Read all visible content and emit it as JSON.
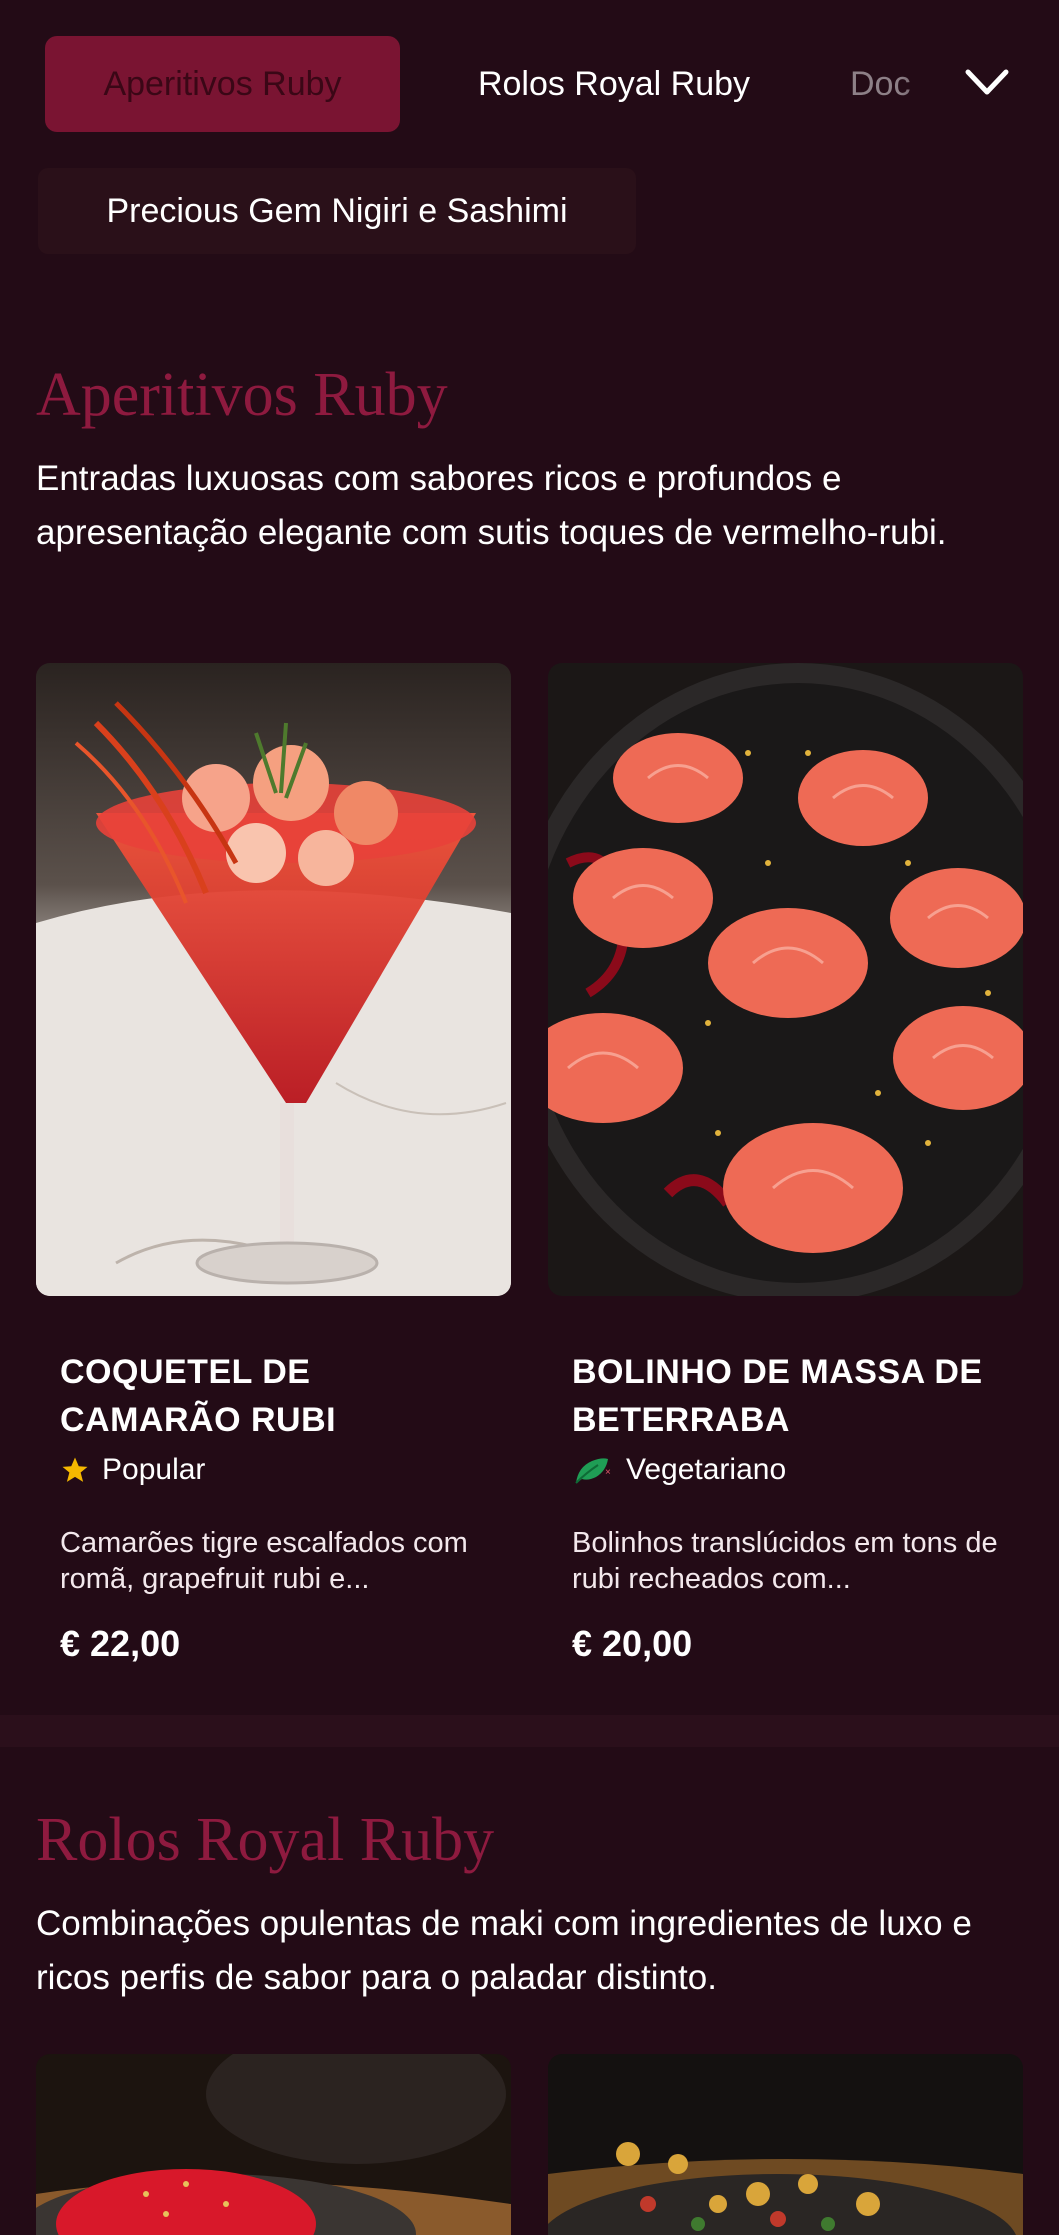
{
  "nav": {
    "tabs": [
      {
        "label": "Aperitivos Ruby",
        "active": true
      },
      {
        "label": "Rolos Royal Ruby",
        "active": false
      },
      {
        "label": "Doces",
        "active": false
      },
      {
        "label": "Precious Gem Nigiri e Sashimi",
        "active": false
      }
    ],
    "visible_partial_tab": "Doc",
    "expand_icon": "chevron-down-icon"
  },
  "sections": [
    {
      "title": "Aperitivos Ruby",
      "description": "Entradas luxuosas com sabores ricos e profundos e apresentação elegante com sutis toques de vermelho-rubi.",
      "items": [
        {
          "name": "COQUETEL DE CAMARÃO RUBI",
          "tag": "Popular",
          "tag_icon": "star-icon",
          "description": "Camarões tigre escalfados com romã, grapefruit rubi e...",
          "price": "€ 22,00"
        },
        {
          "name": "BOLINHO DE MASSA DE BETERRABA",
          "tag": "Vegetariano",
          "tag_icon": "vegetarian-leaf-icon",
          "description": "Bolinhos translúcidos em tons de rubi recheados com...",
          "price": "€ 20,00"
        }
      ]
    },
    {
      "title": "Rolos Royal Ruby",
      "description": "Combinações opulentas de maki com ingredientes de luxo e ricos perfis de sabor para o paladar distinto."
    }
  ],
  "colors": {
    "background": "#230b16",
    "accent": "#7a1432",
    "section_title": "#8e1a3f",
    "star": "#f5b800",
    "vegetarian": "#1f9d55"
  }
}
